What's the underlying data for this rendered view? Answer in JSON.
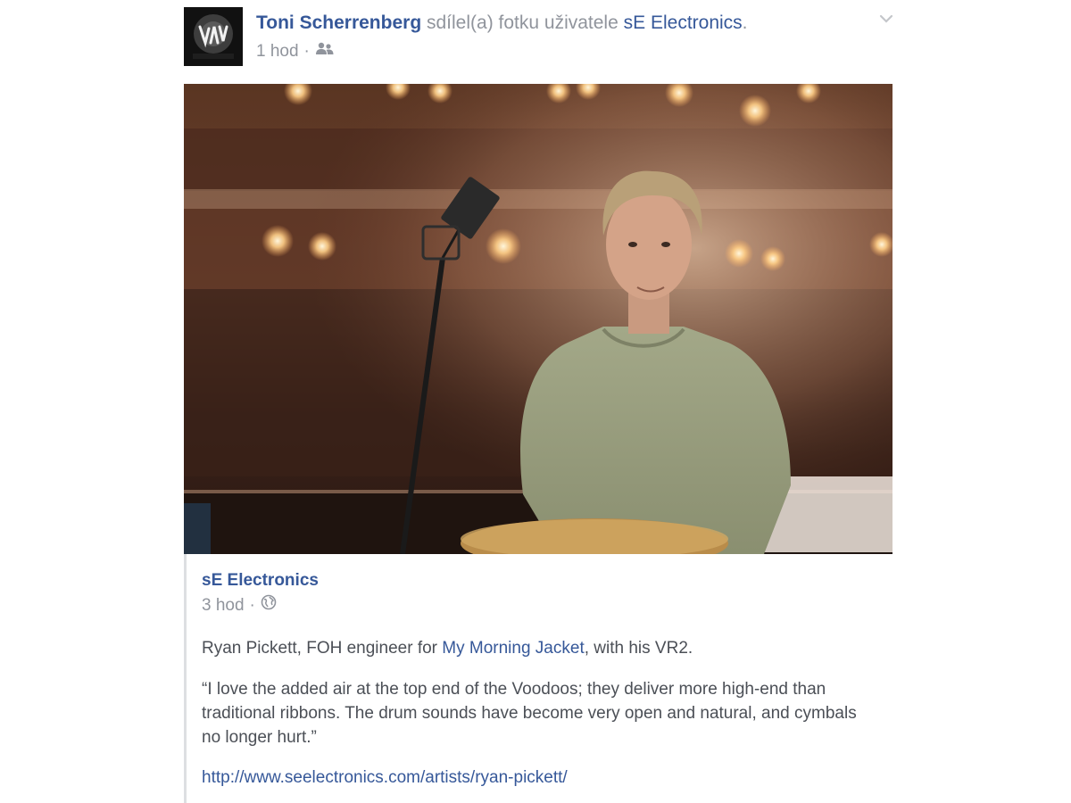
{
  "header": {
    "author": "Toni Scherrenberg",
    "action": "sdílel(a) fotku uživatele",
    "page_link": "sE Electronics",
    "period": ".",
    "time": "1 hod",
    "separator": "·",
    "audience_icon": "friends-icon",
    "menu_icon": "chevron-down-icon"
  },
  "photo": {
    "icon": "photo-image"
  },
  "shared_post": {
    "author": "sE Electronics",
    "time": "3 hod",
    "separator": "·",
    "audience_icon": "globe-icon",
    "p1_before": "Ryan Pickett, FOH engineer for ",
    "p1_link": "My Morning Jacket",
    "p1_after": ", with his VR2.",
    "p2": "“I love the added air at the top end of the Voodoos; they deliver more high-end than traditional ribbons. The drum sounds have become very open and natural, and cymbals no longer hurt.”",
    "url": "http://www.seelectronics.com/artists/ryan-pickett/"
  },
  "colors": {
    "link": "#365899",
    "meta": "#90949c",
    "text": "#4b4f56"
  }
}
